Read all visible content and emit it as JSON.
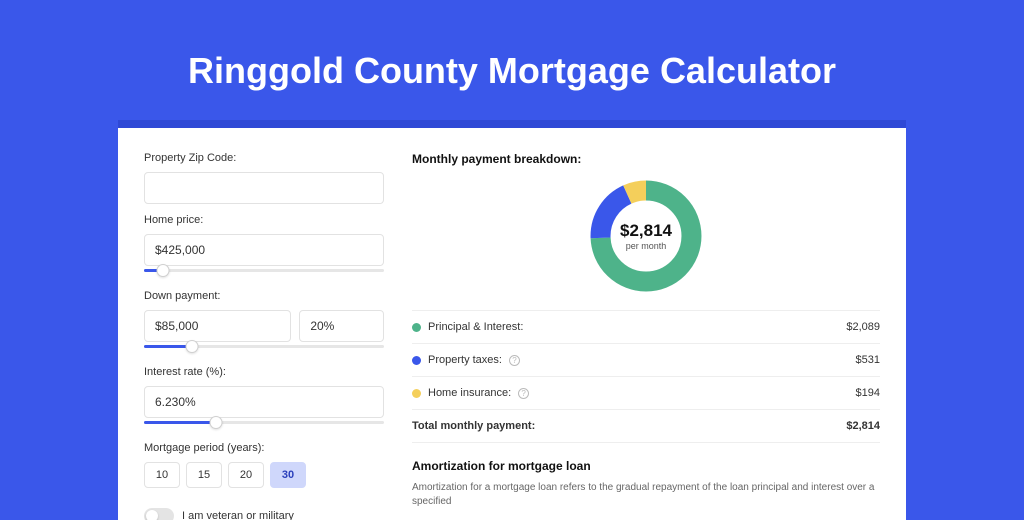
{
  "title": "Ringgold County Mortgage Calculator",
  "left": {
    "zip": {
      "label": "Property Zip Code:",
      "value": ""
    },
    "price": {
      "label": "Home price:",
      "value": "$425,000",
      "slider_pct": 8
    },
    "down": {
      "label": "Down payment:",
      "amount": "$85,000",
      "pct": "20%",
      "slider_pct": 20
    },
    "rate": {
      "label": "Interest rate (%):",
      "value": "6.230%",
      "slider_pct": 30
    },
    "period": {
      "label": "Mortgage period (years):",
      "options": [
        "10",
        "15",
        "20",
        "30"
      ],
      "selected": "30"
    },
    "veteran_label": "I am veteran or military"
  },
  "right": {
    "title": "Monthly payment breakdown:",
    "total_amount": "$2,814",
    "per_month": "per month",
    "colors": {
      "pi": "#4eb38a",
      "tax": "#3a57ea",
      "ins": "#f4cf5b"
    },
    "items": {
      "pi": {
        "label": "Principal & Interest:",
        "value": "$2,089",
        "info": false
      },
      "tax": {
        "label": "Property taxes:",
        "value": "$531",
        "info": true
      },
      "ins": {
        "label": "Home insurance:",
        "value": "$194",
        "info": true
      }
    },
    "total_row": {
      "label": "Total monthly payment:",
      "value": "$2,814"
    },
    "amort_title": "Amortization for mortgage loan",
    "amort_text": "Amortization for a mortgage loan refers to the gradual repayment of the loan principal and interest over a specified"
  },
  "chart_data": {
    "type": "pie",
    "title": "Monthly payment breakdown",
    "series": [
      {
        "name": "Principal & Interest",
        "value": 2089,
        "color": "#4eb38a"
      },
      {
        "name": "Property taxes",
        "value": 531,
        "color": "#3a57ea"
      },
      {
        "name": "Home insurance",
        "value": 194,
        "color": "#f4cf5b"
      }
    ],
    "total": 2814,
    "center_label": "$2,814 per month"
  }
}
